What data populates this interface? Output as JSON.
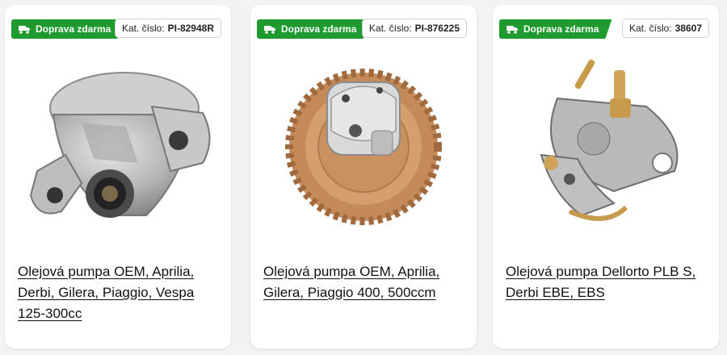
{
  "products": [
    {
      "badge": "Doprava zdarma",
      "cat_label": "Kat. číslo:",
      "cat_number": "PI-82948R",
      "title": "Olejová pumpa OEM, Aprilia, Derbi, Gilera, Piaggio, Vespa 125-300cc"
    },
    {
      "badge": "Doprava zdarma",
      "cat_label": "Kat. číslo:",
      "cat_number": "PI-876225",
      "title": "Olejová pumpa OEM, Aprilia, Gilera, Piaggio 400, 500ccm"
    },
    {
      "badge": "Doprava zdarma",
      "cat_label": "Kat. číslo:",
      "cat_number": "38607",
      "title": "Olejová pumpa Dellorto PLB S, Derbi EBE, EBS"
    }
  ],
  "icons": {
    "badge_icon": "delivery-truck-icon"
  },
  "colors": {
    "badge_bg": "#1f9a2e",
    "text": "#111111",
    "card_bg": "#ffffff",
    "page_bg": "#f3f3f3"
  }
}
